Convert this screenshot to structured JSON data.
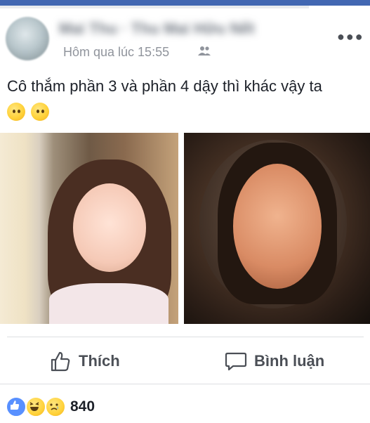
{
  "post": {
    "author_name": "Mai Thu · Thu Mai Hữu Nết",
    "timestamp": "Hôm qua lúc 15:55",
    "text": "Cô thắm phần 3 và phần 4 dậy thì khác vậy ta",
    "emoji": [
      "neutral-face",
      "neutral-face"
    ]
  },
  "actions": {
    "like_label": "Thích",
    "comment_label": "Bình luận"
  },
  "reactions": {
    "types": [
      "like",
      "haha",
      "sad"
    ],
    "count": "840"
  },
  "colors": {
    "brand": "#4267b2",
    "like_blue": "#5890ff",
    "text": "#1d2129",
    "secondary": "#90949c"
  }
}
